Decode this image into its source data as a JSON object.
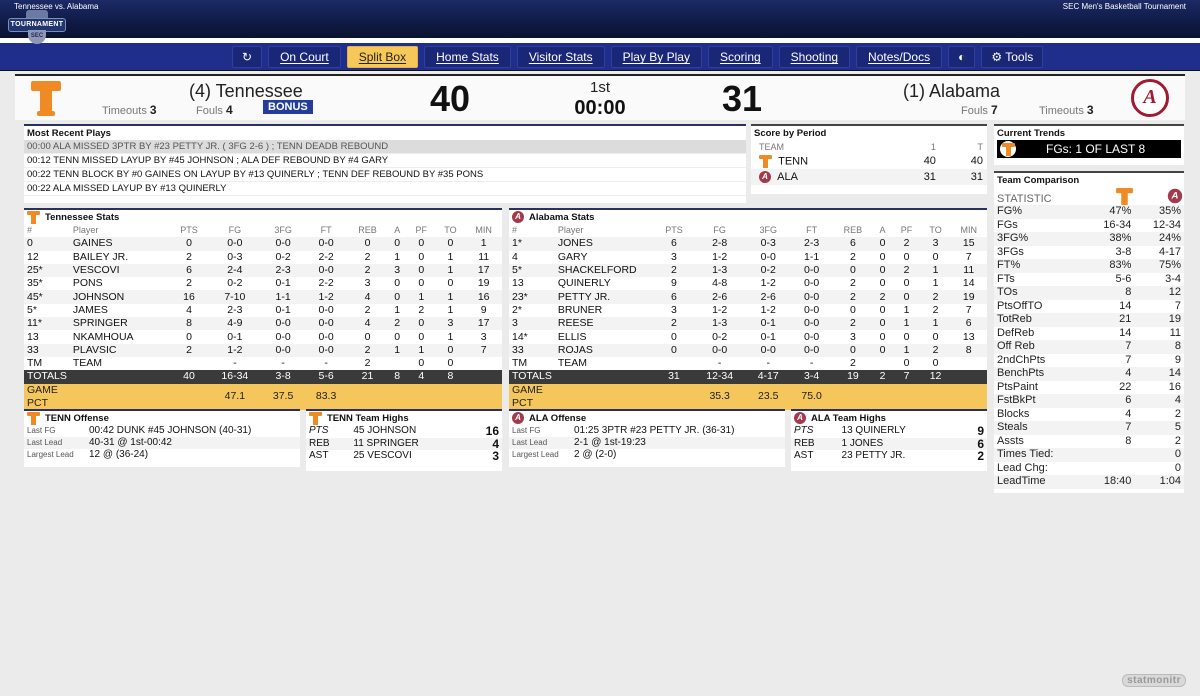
{
  "header": {
    "matchup": "Tennessee vs. Alabama",
    "event": "SEC Men's Basketball Tournament",
    "logo_text": "TOURNAMENT",
    "logo_sub": "SEC"
  },
  "nav": {
    "refresh_icon": "refresh-icon",
    "items": [
      {
        "label": "On Court",
        "active": false
      },
      {
        "label": "Split Box",
        "active": true
      },
      {
        "label": "Home Stats",
        "active": false
      },
      {
        "label": "Visitor Stats",
        "active": false
      },
      {
        "label": "Play By Play",
        "active": false
      },
      {
        "label": "Scoring",
        "active": false
      },
      {
        "label": "Shooting",
        "active": false
      },
      {
        "label": "Notes/Docs",
        "active": false
      }
    ],
    "contrast_icon": "contrast-icon",
    "tools_label": "Tools"
  },
  "scoreboard": {
    "home": {
      "name": "(4) Tennessee",
      "score": "40",
      "timeouts_label": "Timeouts",
      "timeouts": "3",
      "fouls_label": "Fouls",
      "fouls": "4",
      "bonus": "BONUS"
    },
    "away": {
      "name": "(1) Alabama",
      "score": "31",
      "timeouts_label": "Timeouts",
      "timeouts": "3",
      "fouls_label": "Fouls",
      "fouls": "7"
    },
    "period": "1st",
    "clock": "00:00"
  },
  "recent_plays": {
    "title": "Most Recent Plays",
    "items": [
      "00:00 ALA MISSED 3PTR BY #23 PETTY JR. ( 3FG 2-6 ) ; TENN DEADB REBOUND",
      "00:12 TENN MISSED LAYUP BY #45 JOHNSON ; ALA DEF REBOUND BY #4 GARY",
      "00:22 TENN BLOCK BY #0 GAINES ON LAYUP BY #13 QUINERLY ; TENN DEF REBOUND BY #35 PONS",
      "00:22 ALA MISSED LAYUP BY #13 QUINERLY"
    ]
  },
  "score_by_period": {
    "title": "Score by Period",
    "headers": [
      "TEAM",
      "1",
      "T"
    ],
    "rows": [
      {
        "team": "TENN",
        "p1": "40",
        "t": "40"
      },
      {
        "team": "ALA",
        "p1": "31",
        "t": "31"
      }
    ]
  },
  "trends": {
    "title": "Current Trends",
    "text": "FGs: 1 OF LAST 8"
  },
  "columns": [
    "#",
    "Player",
    "PTS",
    "FG",
    "3FG",
    "FT",
    "REB",
    "A",
    "PF",
    "TO",
    "MIN"
  ],
  "tenn_stats": {
    "title": "Tennessee Stats",
    "players": [
      [
        "0",
        "GAINES",
        "0",
        "0-0",
        "0-0",
        "0-0",
        "0",
        "0",
        "0",
        "0",
        "1"
      ],
      [
        "12",
        "BAILEY JR.",
        "2",
        "0-3",
        "0-2",
        "2-2",
        "2",
        "1",
        "0",
        "1",
        "11"
      ],
      [
        "25*",
        "VESCOVI",
        "6",
        "2-4",
        "2-3",
        "0-0",
        "2",
        "3",
        "0",
        "1",
        "17"
      ],
      [
        "35*",
        "PONS",
        "2",
        "0-2",
        "0-1",
        "2-2",
        "3",
        "0",
        "0",
        "0",
        "19"
      ],
      [
        "45*",
        "JOHNSON",
        "16",
        "7-10",
        "1-1",
        "1-2",
        "4",
        "0",
        "1",
        "1",
        "16"
      ],
      [
        "5*",
        "JAMES",
        "4",
        "2-3",
        "0-1",
        "0-0",
        "2",
        "1",
        "2",
        "1",
        "9"
      ],
      [
        "11*",
        "SPRINGER",
        "8",
        "4-9",
        "0-0",
        "0-0",
        "4",
        "2",
        "0",
        "3",
        "17"
      ],
      [
        "13",
        "NKAMHOUA",
        "0",
        "0-1",
        "0-0",
        "0-0",
        "0",
        "0",
        "0",
        "1",
        "3"
      ],
      [
        "33",
        "PLAVSIC",
        "2",
        "1-2",
        "0-0",
        "0-0",
        "2",
        "1",
        "1",
        "0",
        "7"
      ],
      [
        "TM",
        "TEAM",
        "",
        "-",
        "-",
        "-",
        "2",
        "",
        "0",
        "0",
        ""
      ]
    ],
    "totals": [
      "TOTALS",
      "",
      "40",
      "16-34",
      "3-8",
      "5-6",
      "21",
      "8",
      "4",
      "8",
      ""
    ],
    "pct": [
      "GAME PCT",
      "",
      "",
      "47.1",
      "37.5",
      "83.3",
      "",
      "",
      "",
      "",
      ""
    ]
  },
  "ala_stats": {
    "title": "Alabama Stats",
    "players": [
      [
        "1*",
        "JONES",
        "6",
        "2-8",
        "0-3",
        "2-3",
        "6",
        "0",
        "2",
        "3",
        "15"
      ],
      [
        "4",
        "GARY",
        "3",
        "1-2",
        "0-0",
        "1-1",
        "2",
        "0",
        "0",
        "0",
        "7"
      ],
      [
        "5*",
        "SHACKELFORD",
        "2",
        "1-3",
        "0-2",
        "0-0",
        "0",
        "0",
        "2",
        "1",
        "11"
      ],
      [
        "13",
        "QUINERLY",
        "9",
        "4-8",
        "1-2",
        "0-0",
        "2",
        "0",
        "0",
        "1",
        "14"
      ],
      [
        "23*",
        "PETTY JR.",
        "6",
        "2-6",
        "2-6",
        "0-0",
        "2",
        "2",
        "0",
        "2",
        "19"
      ],
      [
        "2*",
        "BRUNER",
        "3",
        "1-2",
        "1-2",
        "0-0",
        "0",
        "0",
        "1",
        "2",
        "7"
      ],
      [
        "3",
        "REESE",
        "2",
        "1-3",
        "0-1",
        "0-0",
        "2",
        "0",
        "1",
        "1",
        "6"
      ],
      [
        "14*",
        "ELLIS",
        "0",
        "0-2",
        "0-1",
        "0-0",
        "3",
        "0",
        "0",
        "0",
        "13"
      ],
      [
        "33",
        "ROJAS",
        "0",
        "0-0",
        "0-0",
        "0-0",
        "0",
        "0",
        "1",
        "2",
        "8"
      ],
      [
        "TM",
        "TEAM",
        "",
        "-",
        "-",
        "-",
        "2",
        "",
        "0",
        "0",
        ""
      ]
    ],
    "totals": [
      "TOTALS",
      "",
      "31",
      "12-34",
      "4-17",
      "3-4",
      "19",
      "2",
      "7",
      "12",
      ""
    ],
    "pct": [
      "GAME PCT",
      "",
      "",
      "35.3",
      "23.5",
      "75.0",
      "",
      "",
      "",
      "",
      ""
    ]
  },
  "tenn_offense": {
    "title": "TENN Offense",
    "rows": [
      {
        "label": "Last FG",
        "value": "00:42 DUNK #45 JOHNSON (40-31)"
      },
      {
        "label": "Last Lead",
        "value": "40-31 @ 1st-00:42"
      },
      {
        "label": "Largest Lead",
        "value": "12 @ (36-24)"
      }
    ]
  },
  "tenn_highs": {
    "title": "TENN Team Highs",
    "rows": [
      {
        "cat": "PTS",
        "player": "45 JOHNSON",
        "value": "16"
      },
      {
        "cat": "REB",
        "player": "11 SPRINGER",
        "value": "4"
      },
      {
        "cat": "AST",
        "player": "25 VESCOVI",
        "value": "3"
      }
    ]
  },
  "ala_offense": {
    "title": "ALA Offense",
    "rows": [
      {
        "label": "Last FG",
        "value": "01:25 3PTR #23 PETTY JR. (36-31)"
      },
      {
        "label": "Last Lead",
        "value": "2-1 @ 1st-19:23"
      },
      {
        "label": "Largest Lead",
        "value": "2 @ (2-0)"
      }
    ]
  },
  "ala_highs": {
    "title": "ALA Team Highs",
    "rows": [
      {
        "cat": "PTS",
        "player": "13 QUINERLY",
        "value": "9"
      },
      {
        "cat": "REB",
        "player": "1 JONES",
        "value": "6"
      },
      {
        "cat": "AST",
        "player": "23 PETTY JR.",
        "value": "2"
      }
    ]
  },
  "comparison": {
    "title": "Team Comparison",
    "header": "STATISTIC",
    "rows": [
      [
        "FG%",
        "47%",
        "35%"
      ],
      [
        "FGs",
        "16-34",
        "12-34"
      ],
      [
        "3FG%",
        "38%",
        "24%"
      ],
      [
        "3FGs",
        "3-8",
        "4-17"
      ],
      [
        "FT%",
        "83%",
        "75%"
      ],
      [
        "FTs",
        "5-6",
        "3-4"
      ],
      [
        "TOs",
        "8",
        "12"
      ],
      [
        "PtsOffTO",
        "14",
        "7"
      ],
      [
        "TotReb",
        "21",
        "19"
      ],
      [
        "DefReb",
        "14",
        "11"
      ],
      [
        "Off Reb",
        "7",
        "8"
      ],
      [
        "2ndChPts",
        "7",
        "9"
      ],
      [
        "BenchPts",
        "4",
        "14"
      ],
      [
        "PtsPaint",
        "22",
        "16"
      ],
      [
        "FstBkPt",
        "6",
        "4"
      ],
      [
        "Blocks",
        "4",
        "2"
      ],
      [
        "Steals",
        "7",
        "5"
      ],
      [
        "Assts",
        "8",
        "2"
      ],
      [
        "Times Tied:",
        "",
        "0"
      ],
      [
        "Lead Chg:",
        "",
        "0"
      ],
      [
        "LeadTime",
        "18:40",
        "1:04"
      ]
    ]
  },
  "footer": {
    "brand": "statmonitr"
  },
  "colors": {
    "tenn_orange": "#f08a24",
    "bama_crimson": "#9e1b32",
    "nav_blue": "#1f2e8a",
    "active_yellow": "#f6c85a"
  }
}
